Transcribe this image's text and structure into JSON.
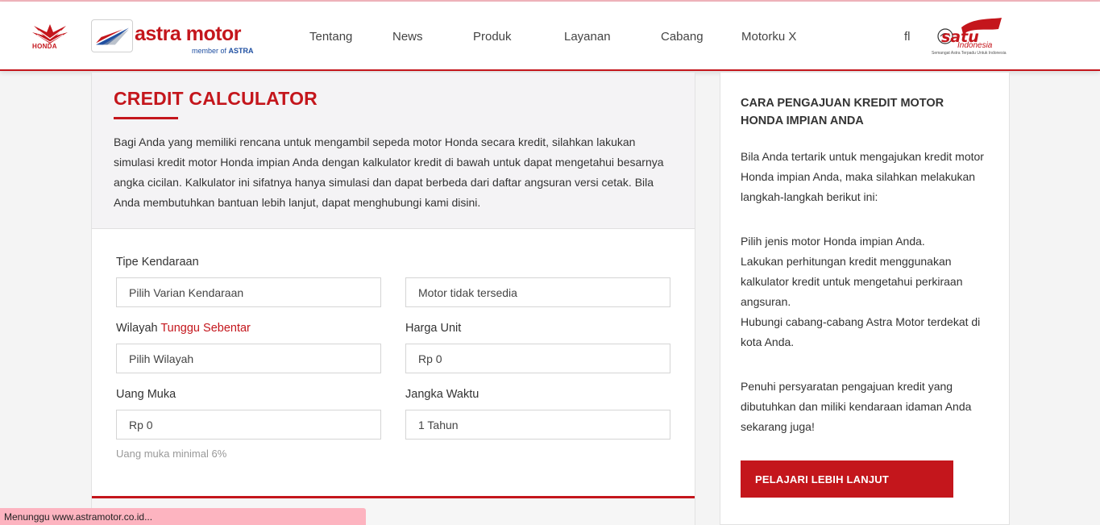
{
  "header": {
    "honda_text": "HONDA",
    "brand_name": "astra motor",
    "brand_tagline_prefix": "member of",
    "brand_tagline_strong": "ASTRA",
    "nav": [
      "Tentang",
      "News",
      "Produk",
      "Layanan",
      "Cabang",
      "Motorku X"
    ],
    "search_icon": "search-icon",
    "satu_text": "satu",
    "satu_indo": "Indonesia",
    "satu_sub": "Semangat Astra Terpadu Untuk Indonesia"
  },
  "calculator": {
    "title": "CREDIT CALCULATOR",
    "intro": "Bagi Anda yang memiliki rencana untuk mengambil sepeda motor Honda secara kredit, silahkan lakukan simulasi kredit motor Honda impian Anda dengan kalkulator kredit di bawah untuk dapat mengetahui besarnya angka cicilan. Kalkulator ini sifatnya hanya simulasi dan dapat berbeda dari daftar angsuran versi cetak. Bila Anda membutuhkan bantuan lebih lanjut, dapat menghubungi kami disini.",
    "tipe_label": "Tipe Kendaraan",
    "varian_value": "Pilih Varian Kendaraan",
    "motor_value": "Motor tidak tersedia",
    "wilayah_label": "Wilayah",
    "wilayah_wait": "Tunggu Sebentar",
    "wilayah_value": "Pilih Wilayah",
    "harga_label": "Harga Unit",
    "harga_value": "Rp 0",
    "uang_muka_label": "Uang Muka",
    "uang_muka_value": "Rp 0",
    "jangka_label": "Jangka Waktu",
    "jangka_value": "1 Tahun",
    "hint": "Uang muka minimal 6%"
  },
  "sidebar": {
    "title": "CARA PENGAJUAN KREDIT MOTOR HONDA IMPIAN ANDA",
    "intro": "Bila Anda tertarik untuk mengajukan kredit motor Honda impian Anda, maka silahkan melakukan langkah-langkah berikut ini:",
    "steps": [
      "Pilih jenis motor Honda impian Anda.",
      "Lakukan perhitungan kredit menggunakan kalkulator kredit untuk mengetahui perkiraan angsuran.",
      "Hubungi cabang-cabang Astra Motor terdekat di kota Anda."
    ],
    "outro": "Penuhi persyaratan pengajuan kredit yang dibutuhkan dan miliki kendaraan idaman Anda sekarang juga!",
    "cta": "PELAJARI LEBIH LANJUT"
  },
  "status_bar": "Menunggu www.astramotor.co.id...",
  "colors": {
    "accent": "#c4161c",
    "brand_blue": "#1f4fa1",
    "status_bar": "#fdb4c0"
  }
}
